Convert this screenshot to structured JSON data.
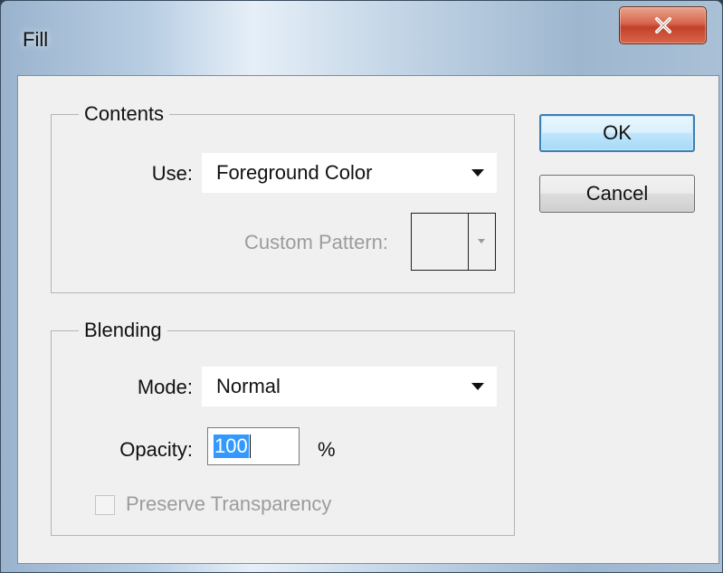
{
  "window": {
    "title": "Fill",
    "close_label": "x"
  },
  "contents": {
    "legend": "Contents",
    "use_label": "Use:",
    "use_value": "Foreground Color",
    "custom_pattern_label": "Custom Pattern:"
  },
  "blending": {
    "legend": "Blending",
    "mode_label": "Mode:",
    "mode_value": "Normal",
    "opacity_label": "Opacity:",
    "opacity_value": "100",
    "opacity_unit": "%",
    "preserve_transparency_label": "Preserve Transparency"
  },
  "buttons": {
    "ok": "OK",
    "cancel": "Cancel"
  },
  "colors": {
    "close_button": "#c3402a",
    "default_button_border": "#3c7fb1",
    "selection_highlight": "#3399ff"
  },
  "icons": {
    "close": "close-icon",
    "dropdown": "chevron-down-icon"
  }
}
